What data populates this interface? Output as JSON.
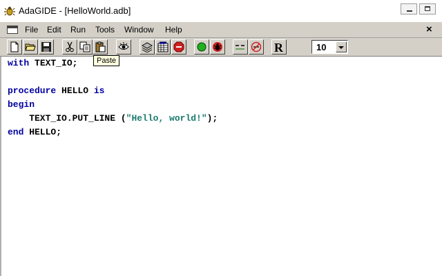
{
  "window": {
    "title": "AdaGIDE - [HelloWorld.adb]",
    "app_icon": "adagide-bug-icon"
  },
  "menu": {
    "items": [
      "File",
      "Edit",
      "Run",
      "Tools",
      "Window",
      "Help"
    ],
    "close_glyph": "×"
  },
  "toolbar": {
    "buttons": [
      "new-file",
      "open-folder",
      "save",
      "cut",
      "copy",
      "paste",
      "view",
      "build",
      "compile-all",
      "stop",
      "run",
      "debug",
      "comment",
      "uncomment",
      "reformat"
    ],
    "font_size": "10",
    "tooltip": "Paste"
  },
  "editor": {
    "lines": [
      [
        "with",
        " TEXT_IO;"
      ],
      [
        "",
        ""
      ],
      [
        "procedure",
        " HELLO ",
        "is"
      ],
      [
        "begin",
        ""
      ],
      [
        "    TEXT_IO.PUT_LINE (",
        "\"Hello, world!\"",
        ");"
      ],
      [
        "end",
        " HELLO;"
      ]
    ]
  },
  "colors": {
    "keyword": "#0000a0",
    "string": "#1a7a6e",
    "chrome": "#d4d0c8"
  }
}
